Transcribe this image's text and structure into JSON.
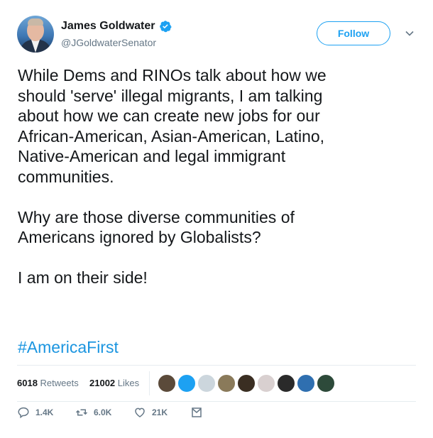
{
  "tweet": {
    "author_name": "James Goldwater",
    "handle": "@JGoldwaterSenator",
    "follow_label": "Follow",
    "body": "While Dems and RINOs talk about how we\nshould 'serve' illegal migrants, I am talking\nabout how we can create new jobs for our\nAfrican-American, Asian-American, Latino,\nNative-American and legal immigrant\ncommunities.\n\nWhy are those diverse communities of\nAmericans ignored by Globalists?\n\nI am on their side!",
    "hashtag": "#AmericaFirst"
  },
  "stats": {
    "retweets_count": "6018",
    "retweets_label": "Retweets",
    "likes_count": "21002",
    "likes_label": "Likes"
  },
  "actions": {
    "replies": "1.4K",
    "retweets": "6.0K",
    "likes": "21K"
  },
  "colors": {
    "accent": "#1da1f2",
    "hashtag": "#1b95e0",
    "muted": "#657786"
  },
  "likers": [
    {
      "color": "#5b4a3a"
    },
    {
      "color": "#1da1f2"
    },
    {
      "color": "#ccd6dd"
    },
    {
      "color": "#8a7a5a"
    },
    {
      "color": "#3a2e22"
    },
    {
      "color": "#d9d0d0"
    },
    {
      "color": "#2a2a2a"
    },
    {
      "color": "#2f6fb0"
    },
    {
      "color": "#2d4a3a"
    }
  ]
}
